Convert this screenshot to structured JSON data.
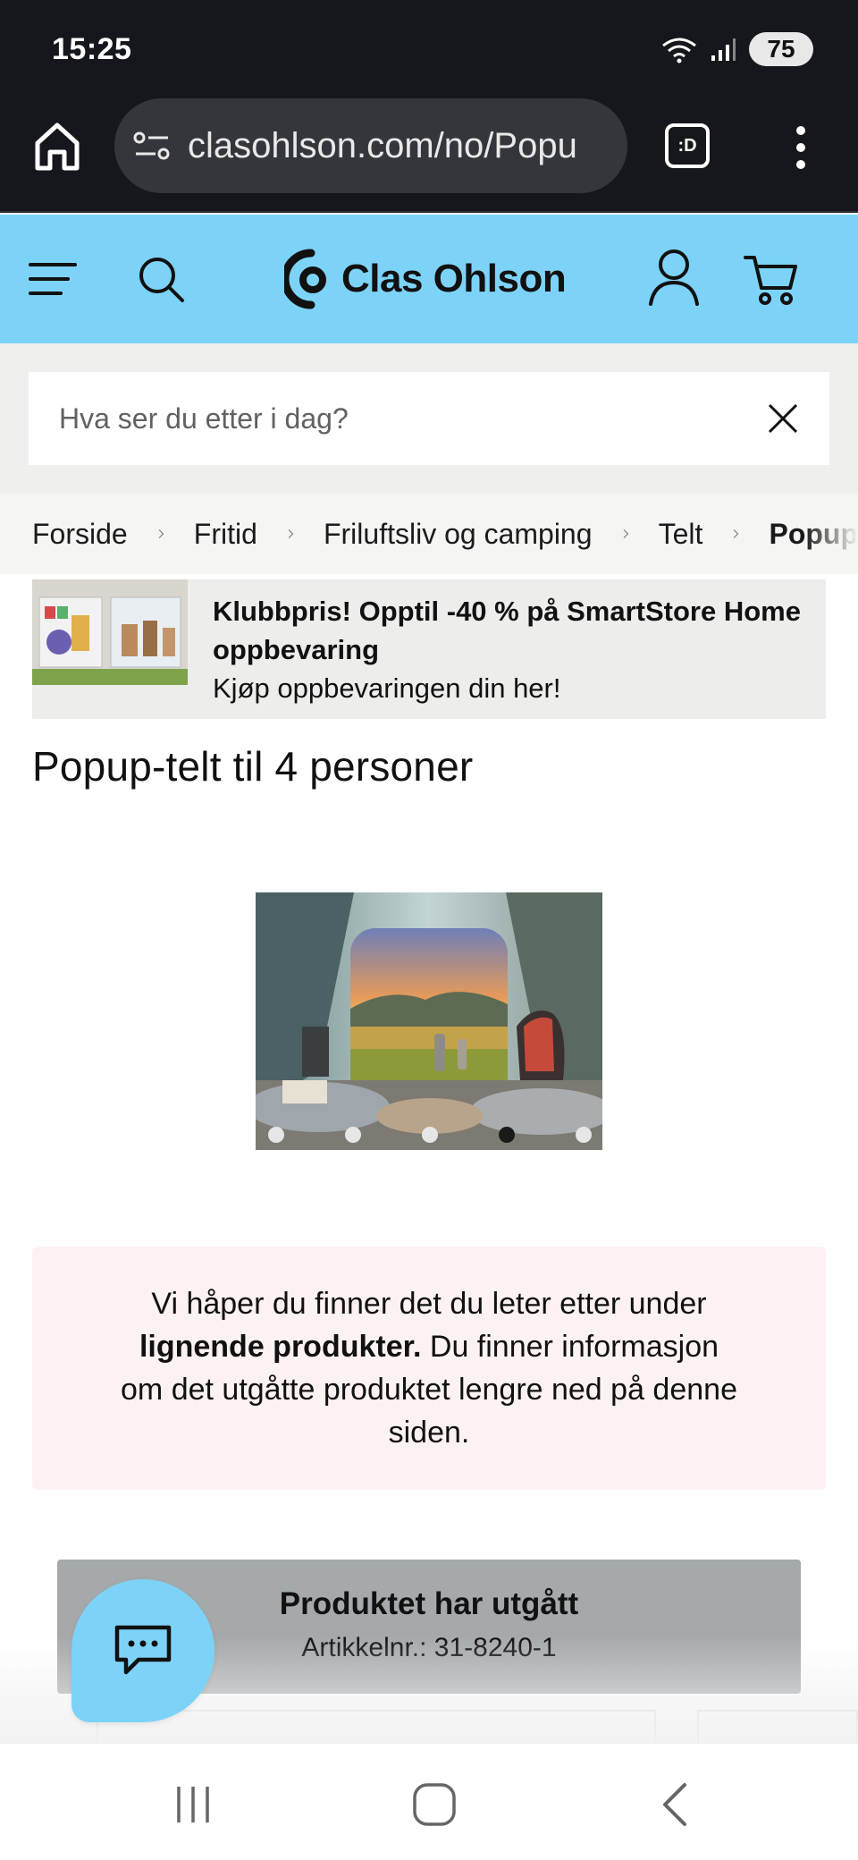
{
  "status_bar": {
    "time": "15:25",
    "battery": "75",
    "icons": [
      "wifi-icon",
      "signal-icon",
      "battery-icon"
    ]
  },
  "browser": {
    "url": "clasohlson.com/no/Popu",
    "tabs_label": ":D"
  },
  "header": {
    "logo_text": "Clas Ohlson",
    "accent_color": "#7dd3f7"
  },
  "search": {
    "placeholder": "Hva ser du etter i dag?"
  },
  "breadcrumb": {
    "items": [
      "Forside",
      "Fritid",
      "Friluftsliv og camping",
      "Telt",
      "Popup"
    ]
  },
  "promo": {
    "title": "Klubbpris! Opptil -40 % på SmartStore Home oppbevaring",
    "subtitle": "Kjøp oppbevaringen din her!"
  },
  "product": {
    "title": "Popup-telt til 4 personer",
    "carousel_count": 5,
    "carousel_active": 4
  },
  "notice": {
    "text_before": "Vi håper du finner det du leter etter under ",
    "text_bold": "lignende produkter.",
    "text_after": " Du finner informasjon om det utgåtte produktet lengre ned på denne siden."
  },
  "discontinued": {
    "title": "Produktet har utgått",
    "sku_label": "Artikkelnr.:  31-8240-1"
  }
}
